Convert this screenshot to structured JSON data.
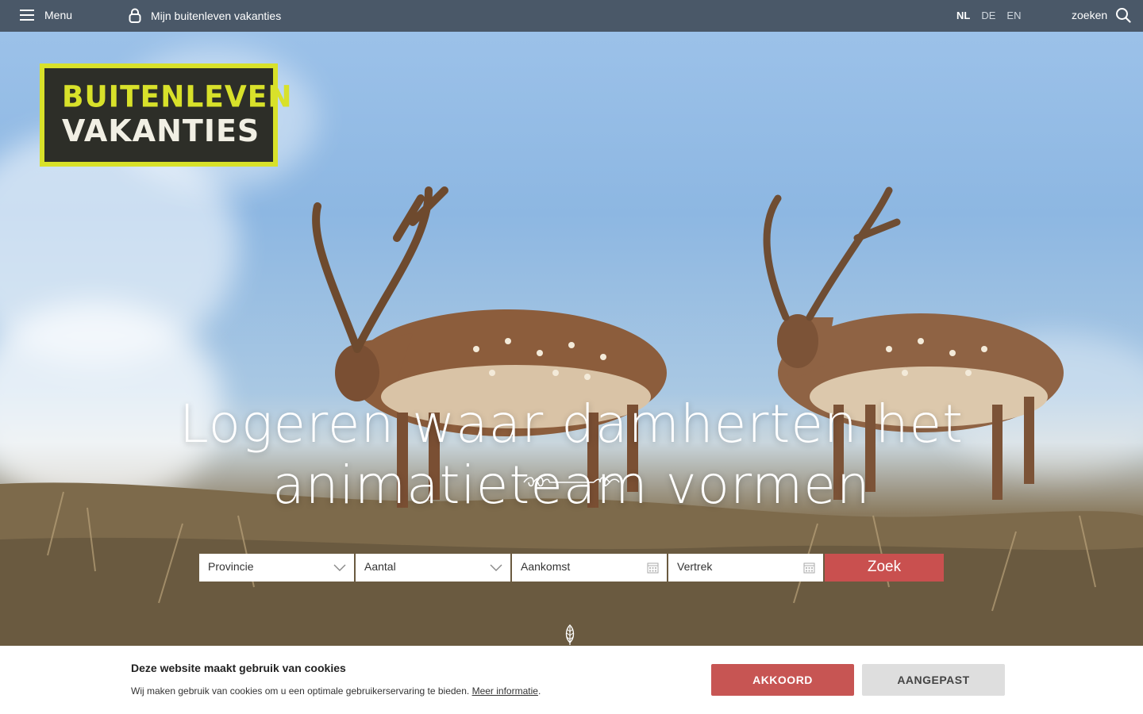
{
  "topbar": {
    "menu_label": "Menu",
    "account_label": "Mijn buitenleven vakanties",
    "languages": [
      "NL",
      "DE",
      "EN"
    ],
    "active_language": "NL",
    "search_label": "zoeken"
  },
  "logo": {
    "line1": "BUITENLEVEN",
    "line2": "VAKANTIES"
  },
  "hero": {
    "headline": "Logeren waar damherten het animatieteam vormen"
  },
  "search_form": {
    "provincie_placeholder": "Provincie",
    "aantal_placeholder": "Aantal",
    "aankomst_placeholder": "Aankomst",
    "vertrek_placeholder": "Vertrek",
    "submit_label": "Zoek"
  },
  "cookie": {
    "title": "Deze website maakt gebruik van cookies",
    "text": "Wij maken gebruik van cookies om u een optimale gebruikerservaring te bieden.",
    "link": "Meer informatie",
    "accept_label": "AKKOORD",
    "custom_label": "AANGEPAST"
  },
  "colors": {
    "topbar": "#4a5868",
    "logo_yellow": "#d8e12a",
    "logo_dark": "#2d2e28",
    "accent_red": "#c9504f",
    "button_grey": "#dedede"
  }
}
